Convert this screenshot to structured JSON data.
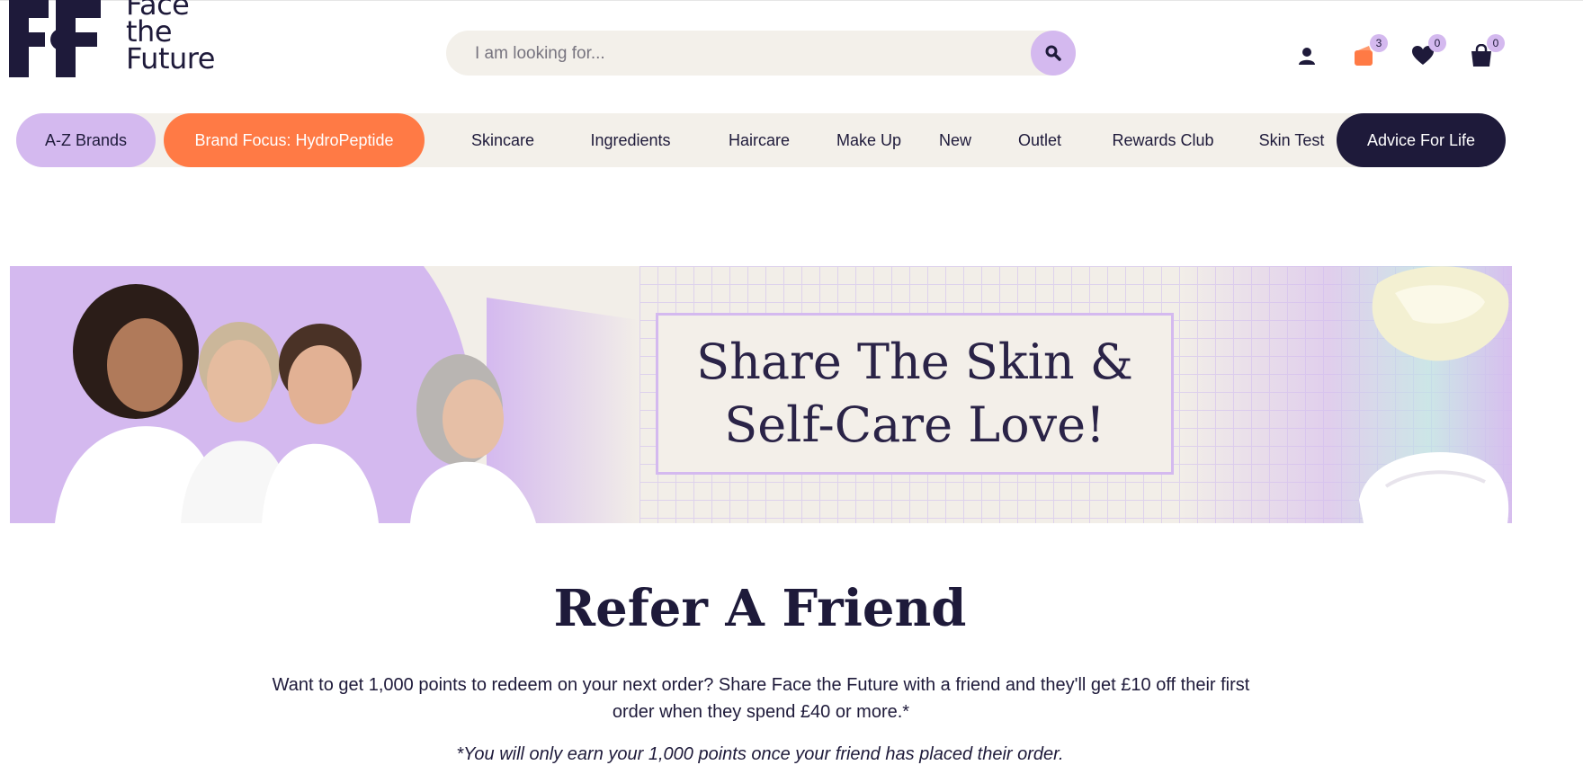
{
  "logo": {
    "line1": "Face",
    "line2": "the",
    "line3": "Future"
  },
  "search": {
    "placeholder": "I am looking for..."
  },
  "header_icons": {
    "account_icon": "user-icon",
    "rewards_count": "3",
    "wishlist_count": "0",
    "basket_count": "0"
  },
  "nav": {
    "items": [
      "A-Z Brands",
      "Brand Focus: HydroPeptide",
      "Skincare",
      "Ingredients",
      "Haircare",
      "Make Up",
      "New",
      "Outlet",
      "Rewards Club",
      "Skin Test",
      "Advice For Life"
    ]
  },
  "banner": {
    "line1": "Share The Skin &",
    "line2": "Self-Care Love!"
  },
  "content": {
    "title": "Refer A Friend",
    "intro": "Want to get 1,000 points to redeem on your next order? Share Face the Future with a friend and they'll get £10 off their first order when they spend £40 or more.*",
    "note": "*You will only earn your 1,000 points once your friend has placed their order."
  },
  "colors": {
    "brand_dark": "#1e1a3a",
    "lilac": "#d4b9ef",
    "orange": "#ff7a45",
    "cream": "#f3f0ea"
  }
}
